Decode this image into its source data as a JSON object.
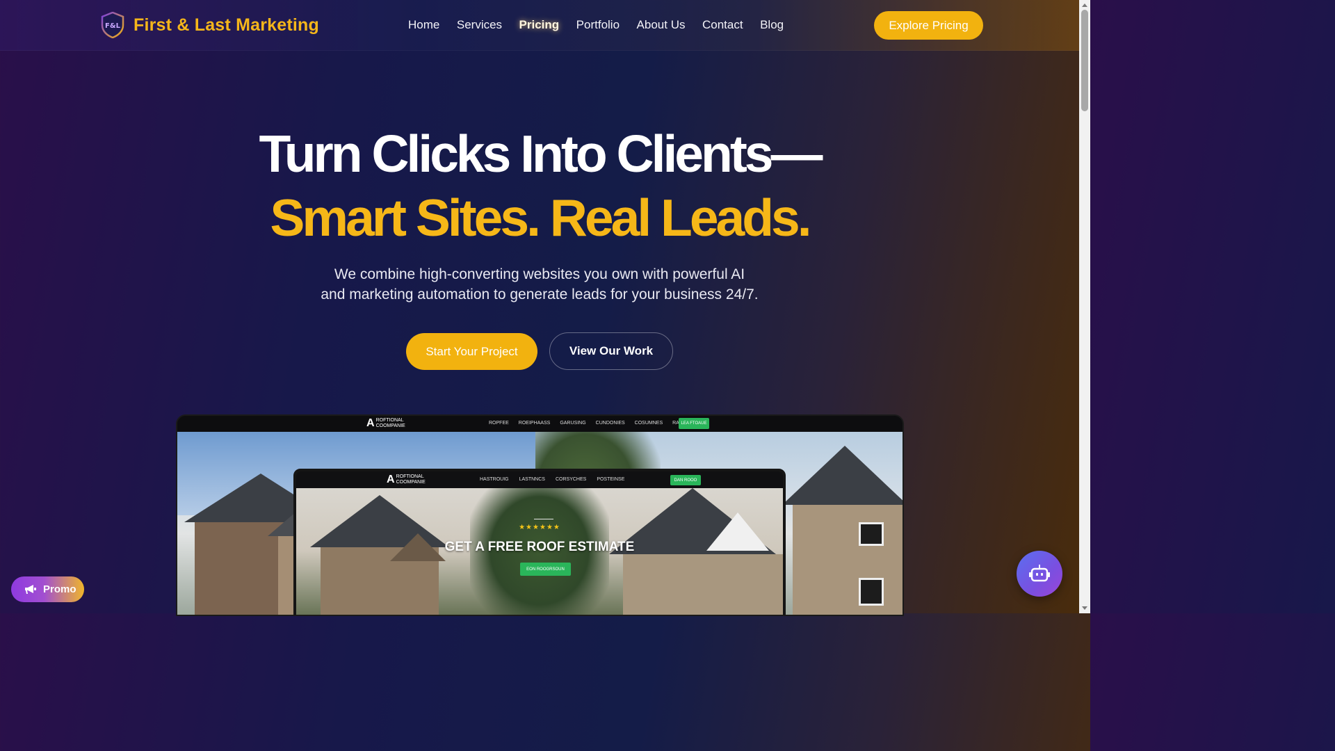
{
  "header": {
    "logo_text": "First & Last Marketing",
    "logo_mark_text": "F&L",
    "nav": [
      "Home",
      "Services",
      "Pricing",
      "Portfolio",
      "About Us",
      "Contact",
      "Blog"
    ],
    "active_nav": "Pricing",
    "cta_label": "Explore Pricing"
  },
  "hero": {
    "title_line1": "Turn Clicks Into Clients—",
    "title_line2": "Smart Sites. Real Leads.",
    "subtitle_line1": "We combine high-converting websites you own with powerful AI",
    "subtitle_line2": "and marketing automation to generate leads for your business 24/7.",
    "primary_button": "Start Your Project",
    "secondary_button": "View Our Work"
  },
  "preview": {
    "logo_line1": "ROFTIONAL",
    "logo_line2": "COOMPANIE",
    "nav": [
      "ROPFEE",
      "ROEIPHAASS",
      "GARUSING",
      "CUNDONIES",
      "COSUMNES",
      "RAEDT"
    ],
    "cta": "LEA FTOAUE",
    "inner": {
      "logo_line1": "ROFTIONAL",
      "logo_line2": "COOMPANIE",
      "nav": [
        "HASTROUIG",
        "LASTNNCS",
        "CORSYCHES",
        "POSTEINSE"
      ],
      "cta": "DAN ROOO",
      "stars": "★★★★★★",
      "headline": "GET A FREE ROOF ESTIMATE",
      "button": "EON ROOGRSOUN"
    }
  },
  "floating": {
    "promo_label": "Promo",
    "chatbot_icon": "robot-icon"
  },
  "colors": {
    "accent": "#f2b20f",
    "green_cta": "#2ab55a"
  }
}
